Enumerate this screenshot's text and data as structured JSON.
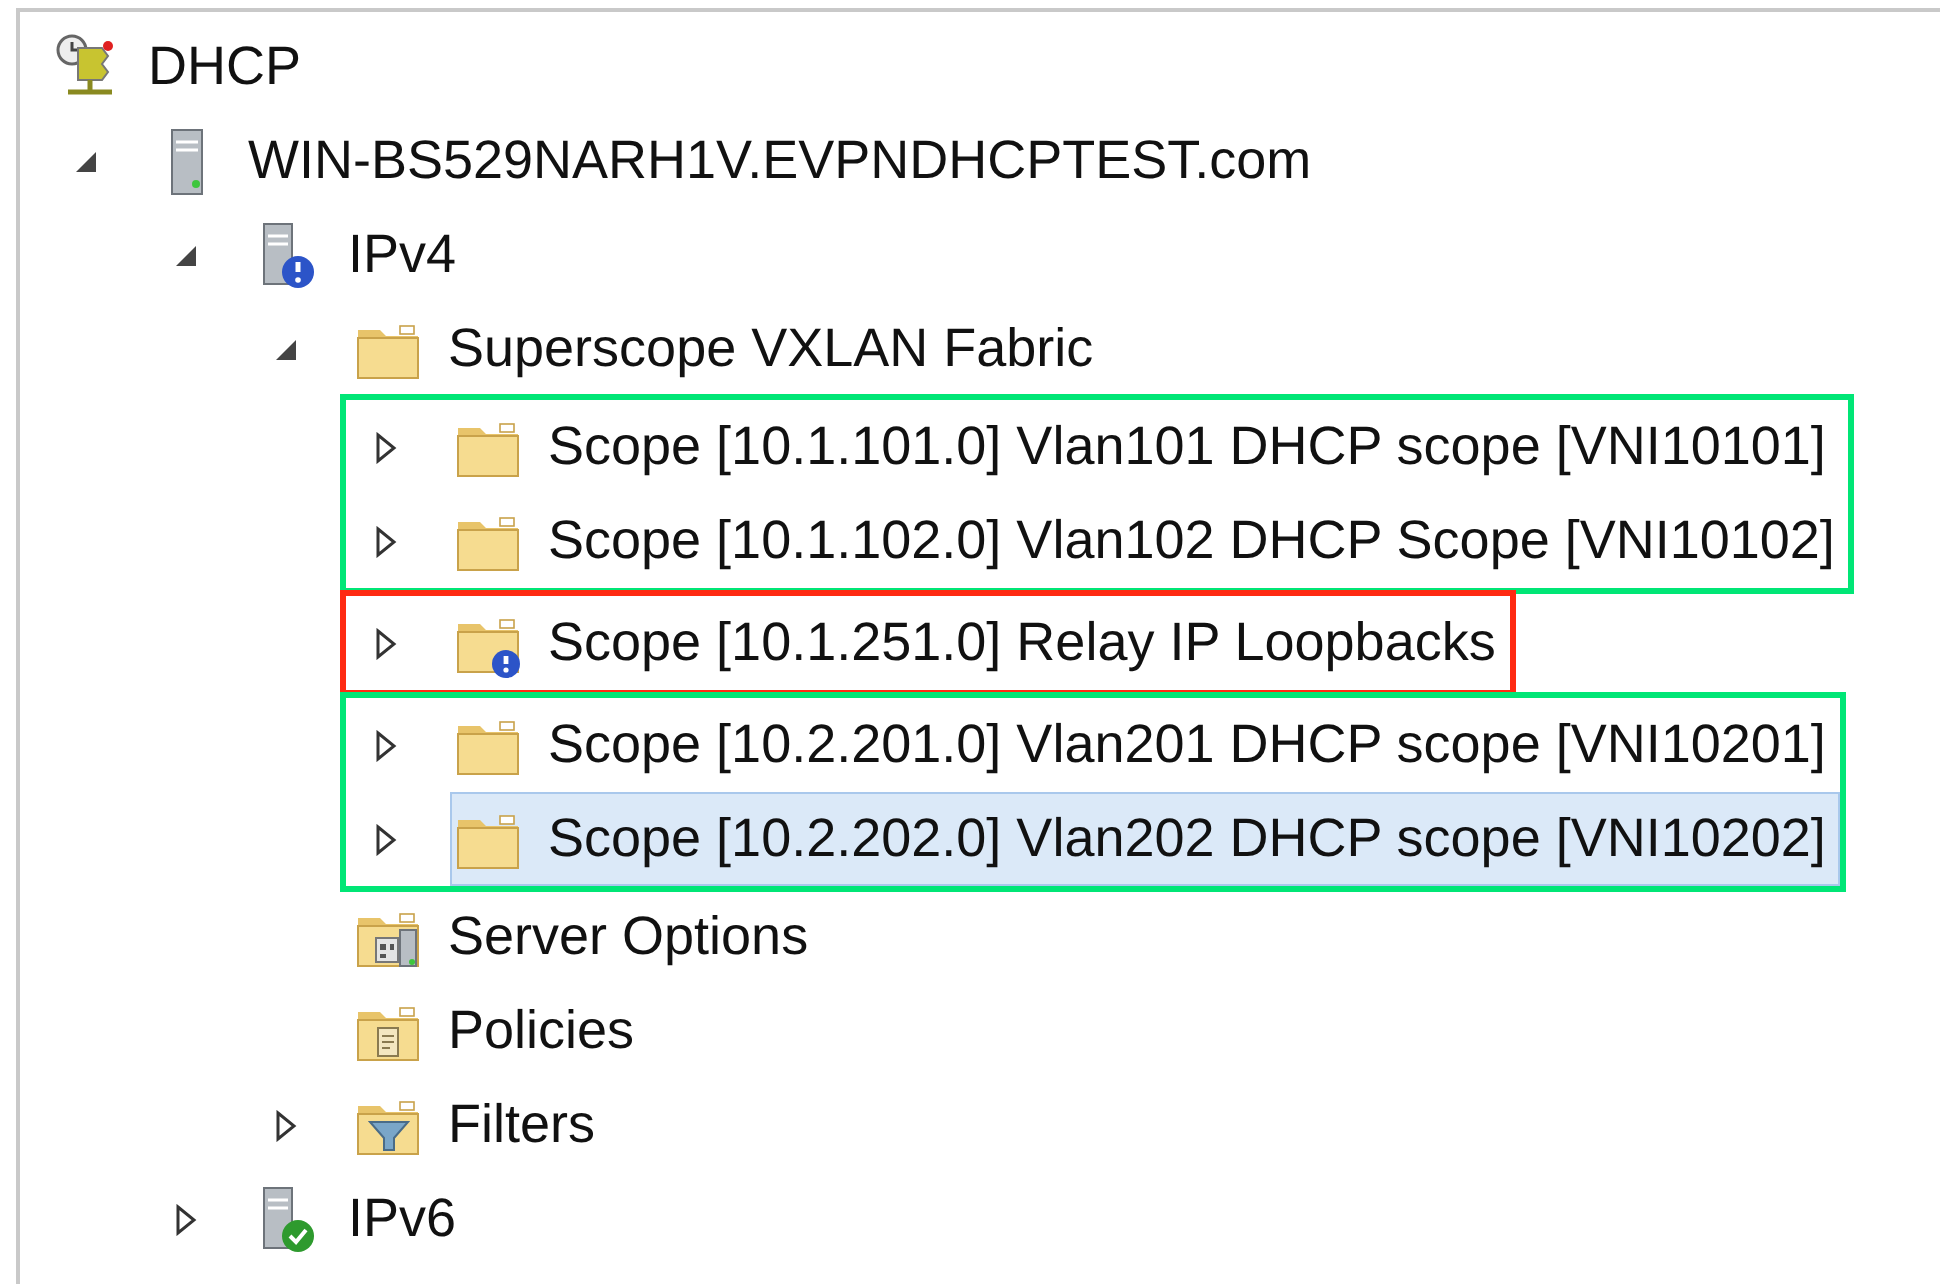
{
  "tree": [
    {
      "label": "DHCP",
      "kind": "dhcp",
      "selected": false,
      "children": [
        {
          "label": "WIN-BS529NARH1V.EVPNDHCPTEST.com",
          "kind": "server",
          "expanded": true,
          "selected": false,
          "children": [
            {
              "label": "IPv4",
              "kind": "ipv4",
              "expanded": true,
              "selected": false,
              "children": [
                {
                  "label": "Superscope VXLAN Fabric",
                  "kind": "folder",
                  "expanded": true,
                  "selected": false,
                  "groups": [
                    {
                      "color": "#00e676",
                      "children": [
                        {
                          "label": "Scope [10.1.101.0] Vlan101 DHCP scope [VNI10101]",
                          "kind": "folder",
                          "expanded": false,
                          "selected": false
                        },
                        {
                          "label": "Scope [10.1.102.0] Vlan102 DHCP Scope [VNI10102]",
                          "kind": "folder",
                          "expanded": false,
                          "selected": false
                        }
                      ]
                    },
                    {
                      "color": "#ff2a12",
                      "children": [
                        {
                          "label": "Scope [10.1.251.0] Relay IP Loopbacks",
                          "kind": "folder-warning",
                          "expanded": false,
                          "selected": false
                        }
                      ]
                    },
                    {
                      "color": "#00e676",
                      "children": [
                        {
                          "label": "Scope [10.2.201.0] Vlan201 DHCP scope [VNI10201]",
                          "kind": "folder",
                          "expanded": false,
                          "selected": false
                        },
                        {
                          "label": "Scope [10.2.202.0] Vlan202 DHCP scope [VNI10202]",
                          "kind": "folder",
                          "expanded": false,
                          "selected": true
                        }
                      ]
                    }
                  ]
                },
                {
                  "label": "Server Options",
                  "kind": "server-options",
                  "selected": false
                },
                {
                  "label": "Policies",
                  "kind": "policies",
                  "selected": false
                },
                {
                  "label": "Filters",
                  "kind": "filters",
                  "expanded": false,
                  "selected": false
                }
              ]
            },
            {
              "label": "IPv6",
              "kind": "ipv6",
              "expanded": false,
              "selected": false
            }
          ]
        }
      ]
    }
  ]
}
